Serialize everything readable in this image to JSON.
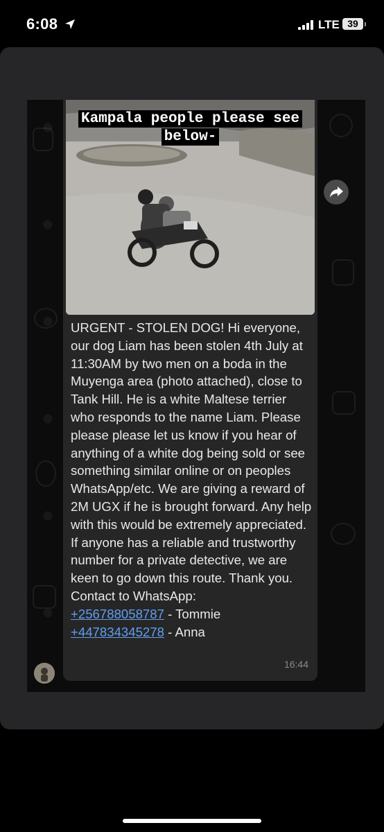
{
  "status_bar": {
    "time": "6:08",
    "network": "LTE",
    "battery": "39",
    "icons": [
      "location-arrow-icon",
      "signal-icon",
      "battery-icon"
    ]
  },
  "image_caption": {
    "line1": "Kampala people please see",
    "line2": "below-"
  },
  "message": {
    "paragraphs": [
      "URGENT - STOLEN DOG!  Hi everyone, our dog Liam has been stolen 4th July at 11:30AM by two men on a boda in the Muyenga area (photo attached), close to Tank Hill. He is a white Maltese terrier who responds to the name Liam.   Please please please let us know if you hear of anything of a white dog being sold or see something similar online or on peoples WhatsApp/etc.   We are giving a reward of 2M UGX if he is brought forward. Any help with this would be extremely appreciated.   If anyone has a reliable and trustworthy number for a private detective, we are keen to go down this route.   Thank you.  Contact to WhatsApp:"
    ],
    "contacts": [
      {
        "phone": "+256788058787",
        "name": " - Tommie"
      },
      {
        "phone": "+447834345278",
        "name": " - Anna"
      }
    ],
    "time": "16:44"
  },
  "colors": {
    "bubble": "#262626",
    "link": "#5f9ff0",
    "sheet": "#262628",
    "chat_bg": "#0c0c0c"
  }
}
